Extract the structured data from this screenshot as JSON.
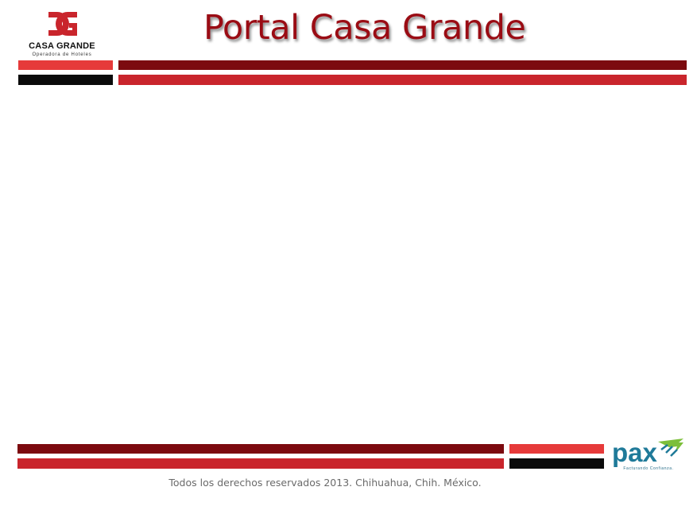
{
  "header": {
    "logo": {
      "name": "CASA GRANDE",
      "subtitle": "Operadora de Hoteles"
    },
    "title": "Portal Casa Grande"
  },
  "footer": {
    "copyright": "Todos los derechos reservados 2013. Chihuahua, Chih. México.",
    "partner_logo": {
      "name": "pax",
      "tagline": "Facturando Confianza."
    }
  },
  "colors": {
    "dark_red": "#7c0a0f",
    "red": "#c9252c",
    "bright_red": "#e63a3a",
    "black": "#0b0b0b",
    "title": "#9a0c14",
    "pax_teal": "#1f7a99",
    "pax_green": "#7cbf3a"
  }
}
